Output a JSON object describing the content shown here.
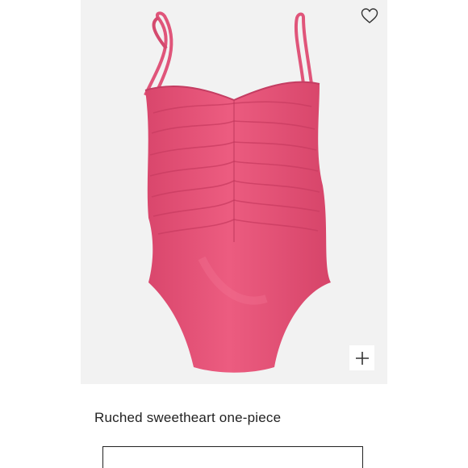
{
  "product": {
    "name": "Ruched sweetheart one-piece",
    "image_alt": "Pink ruched one-piece swimsuit",
    "swatch_color": "#e8587a"
  },
  "icons": {
    "wishlist": "heart-outline-icon",
    "quick_add": "plus-icon"
  }
}
